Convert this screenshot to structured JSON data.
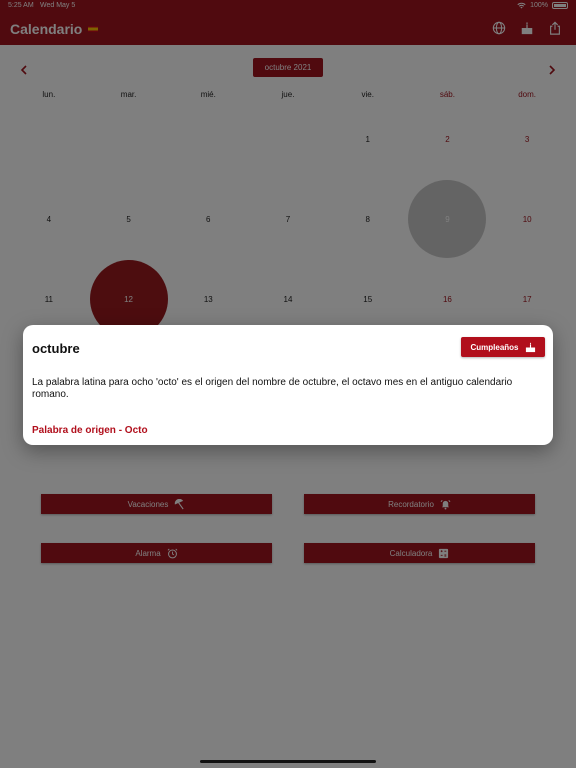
{
  "status_bar": {
    "time": "5:25 AM",
    "date": "Wed May 5",
    "battery": "100%"
  },
  "app_bar": {
    "title": "Calendario",
    "icons": [
      "globe-icon",
      "birthday-cake-icon",
      "share-icon"
    ],
    "accent_color": "#a0141e"
  },
  "calendar": {
    "month_label": "octubre 2021",
    "weekdays": [
      "lun.",
      "mar.",
      "mié.",
      "jue.",
      "vie.",
      "sáb.",
      "dom."
    ],
    "weeks": [
      [
        "",
        "",
        "",
        "",
        "1",
        "2",
        "3"
      ],
      [
        "4",
        "5",
        "6",
        "7",
        "8",
        "9",
        "10"
      ],
      [
        "11",
        "12",
        "13",
        "14",
        "15",
        "16",
        "17"
      ]
    ],
    "today": "12",
    "selected": "9"
  },
  "actions": [
    {
      "label": "Vacaciones",
      "icon": "beach-umbrella-icon"
    },
    {
      "label": "Recordatorio",
      "icon": "alarm-bell-icon"
    },
    {
      "label": "Alarma",
      "icon": "alarm-clock-icon"
    },
    {
      "label": "Calculadora",
      "icon": "calculator-icon"
    }
  ],
  "dialog": {
    "title": "octubre",
    "button_label": "Cumpleaños",
    "text": "La palabra latina para ocho 'octo' es el origen del nombre de octubre, el octavo mes en el antiguo calendario romano.",
    "link": "Palabra de origen - Octo"
  }
}
